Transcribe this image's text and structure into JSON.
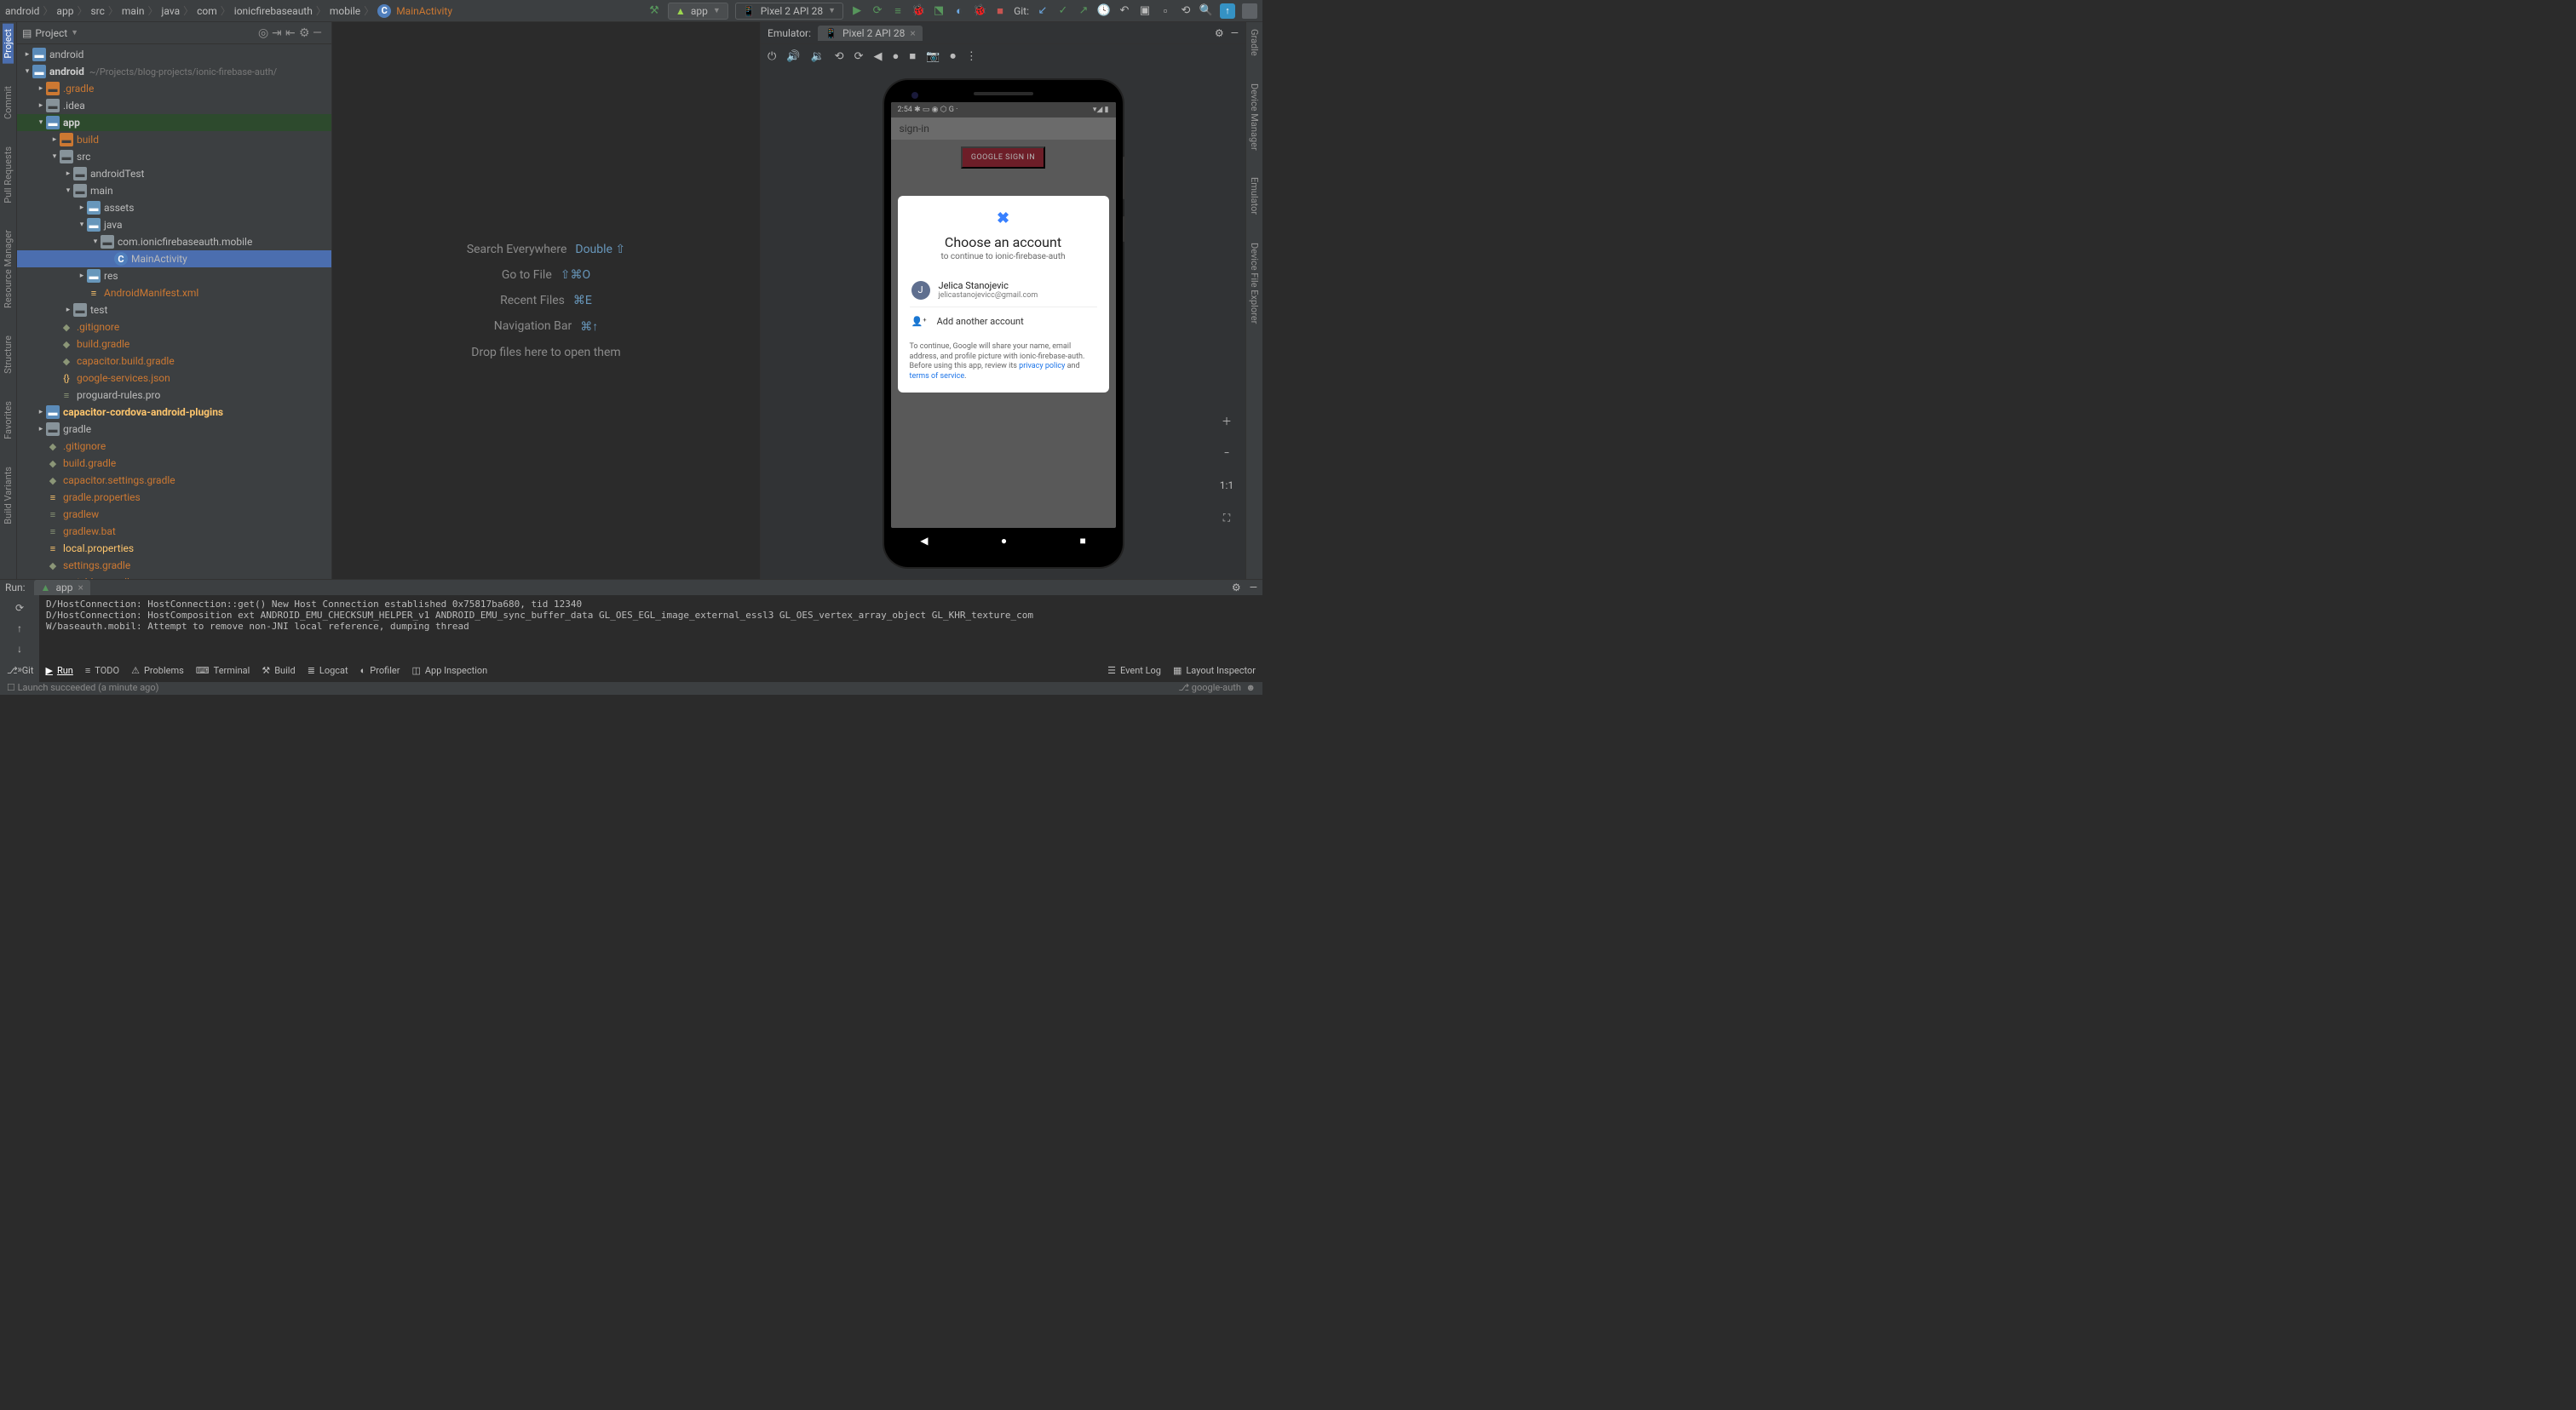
{
  "breadcrumb": [
    "android",
    "app",
    "src",
    "main",
    "java",
    "com",
    "ionicfirebaseauth",
    "mobile",
    "MainActivity"
  ],
  "runConfig": {
    "label": "app"
  },
  "deviceSel": {
    "label": "Pixel 2 API 28"
  },
  "gitLabel": "Git:",
  "projectPanel": {
    "title": "Project"
  },
  "leftStrip": [
    "Project",
    "Commit",
    "Pull Requests",
    "Resource Manager",
    "Structure",
    "Favorites",
    "Build Variants"
  ],
  "rightStrip": [
    "Gradle",
    "Device Manager",
    "Emulator",
    "Device File Explorer"
  ],
  "tree": [
    {
      "d": 0,
      "tw": "▸",
      "icon": "folder-mod",
      "label": "android",
      "cls": ""
    },
    {
      "d": 0,
      "tw": "▾",
      "icon": "folder-mod",
      "label": "android",
      "cls": "bold",
      "suffix": "~/Projects/blog-projects/ionic-firebase-auth/"
    },
    {
      "d": 1,
      "tw": "▸",
      "icon": "folder-o",
      "label": ".gradle",
      "cls": "or"
    },
    {
      "d": 1,
      "tw": "▸",
      "icon": "folder",
      "label": ".idea",
      "cls": ""
    },
    {
      "d": 1,
      "tw": "▾",
      "icon": "folder-mod",
      "label": "app",
      "cls": "bold",
      "hl": true
    },
    {
      "d": 2,
      "tw": "▸",
      "icon": "folder-o",
      "label": "build",
      "cls": "or"
    },
    {
      "d": 2,
      "tw": "▾",
      "icon": "folder",
      "label": "src",
      "cls": ""
    },
    {
      "d": 3,
      "tw": "▸",
      "icon": "folder",
      "label": "androidTest",
      "cls": ""
    },
    {
      "d": 3,
      "tw": "▾",
      "icon": "folder",
      "label": "main",
      "cls": ""
    },
    {
      "d": 4,
      "tw": "▸",
      "icon": "folder-b",
      "label": "assets",
      "cls": ""
    },
    {
      "d": 4,
      "tw": "▾",
      "icon": "folder-b",
      "label": "java",
      "cls": ""
    },
    {
      "d": 5,
      "tw": "▾",
      "icon": "folder",
      "label": "com.ionicfirebaseauth.mobile",
      "cls": ""
    },
    {
      "d": 6,
      "tw": "",
      "icon": "file-c",
      "label": "MainActivity",
      "cls": "",
      "sel": true,
      "ic": "C"
    },
    {
      "d": 4,
      "tw": "▸",
      "icon": "folder-b",
      "label": "res",
      "cls": ""
    },
    {
      "d": 4,
      "tw": "",
      "icon": "file-j",
      "label": "AndroidManifest.xml",
      "cls": "or",
      "ic": "≡"
    },
    {
      "d": 3,
      "tw": "▸",
      "icon": "folder",
      "label": "test",
      "cls": ""
    },
    {
      "d": 2,
      "tw": "",
      "icon": "file-g",
      "label": ".gitignore",
      "cls": "or",
      "ic": "◆"
    },
    {
      "d": 2,
      "tw": "",
      "icon": "file-g",
      "label": "build.gradle",
      "cls": "or",
      "ic": "◆"
    },
    {
      "d": 2,
      "tw": "",
      "icon": "file-g",
      "label": "capacitor.build.gradle",
      "cls": "or",
      "ic": "◆"
    },
    {
      "d": 2,
      "tw": "",
      "icon": "file-j",
      "label": "google-services.json",
      "cls": "or",
      "ic": "{}"
    },
    {
      "d": 2,
      "tw": "",
      "icon": "file-g",
      "label": "proguard-rules.pro",
      "cls": "",
      "ic": "≡"
    },
    {
      "d": 1,
      "tw": "▸",
      "icon": "folder-mod",
      "label": "capacitor-cordova-android-plugins",
      "cls": "gr bold"
    },
    {
      "d": 1,
      "tw": "▸",
      "icon": "folder",
      "label": "gradle",
      "cls": ""
    },
    {
      "d": 1,
      "tw": "",
      "icon": "file-g",
      "label": ".gitignore",
      "cls": "or",
      "ic": "◆"
    },
    {
      "d": 1,
      "tw": "",
      "icon": "file-g",
      "label": "build.gradle",
      "cls": "or",
      "ic": "◆"
    },
    {
      "d": 1,
      "tw": "",
      "icon": "file-g",
      "label": "capacitor.settings.gradle",
      "cls": "or",
      "ic": "◆"
    },
    {
      "d": 1,
      "tw": "",
      "icon": "file-j",
      "label": "gradle.properties",
      "cls": "or",
      "ic": "≡"
    },
    {
      "d": 1,
      "tw": "",
      "icon": "file-g",
      "label": "gradlew",
      "cls": "or",
      "ic": "≡"
    },
    {
      "d": 1,
      "tw": "",
      "icon": "file-g",
      "label": "gradlew.bat",
      "cls": "or",
      "ic": "≡"
    },
    {
      "d": 1,
      "tw": "",
      "icon": "file-j",
      "label": "local.properties",
      "cls": "gr",
      "ic": "≡"
    },
    {
      "d": 1,
      "tw": "",
      "icon": "file-g",
      "label": "settings.gradle",
      "cls": "or",
      "ic": "◆"
    },
    {
      "d": 1,
      "tw": "",
      "icon": "file-g",
      "label": "variables.gradle",
      "cls": "or",
      "ic": "◆"
    }
  ],
  "hints": [
    {
      "label": "Search Everywhere",
      "key": "Double ⇧"
    },
    {
      "label": "Go to File",
      "key": "⇧⌘O"
    },
    {
      "label": "Recent Files",
      "key": "⌘E"
    },
    {
      "label": "Navigation Bar",
      "key": "⌘↑"
    },
    {
      "label": "Drop files here to open them",
      "key": ""
    }
  ],
  "emulator": {
    "headerLabel": "Emulator:",
    "tab": "Pixel 2 API 28",
    "status": {
      "time": "2:54",
      "iconsLeft": "✱ ▭ ◉ ⬡ G ·",
      "iconsRight": "▾◢ ▮"
    },
    "appHeader": "sign-in",
    "gsBtn": "GOOGLE SIGN IN",
    "sheet": {
      "title": "Choose an account",
      "sub": "to continue to ionic-firebase-auth",
      "acct": {
        "initial": "J",
        "name": "Jelica Stanojevic",
        "email": "jelicastanojevicc@gmail.com"
      },
      "add": "Add another account",
      "consentPre": "To continue, Google will share your name, email address, and profile picture with ionic-firebase-auth. Before using this app, review its ",
      "pp": "privacy policy",
      "and": " and ",
      "tos": "terms of service",
      "dot": "."
    },
    "sideBtns": [
      "＋",
      "−",
      "1:1",
      "⛶"
    ]
  },
  "run": {
    "label": "Run:",
    "tab": "app",
    "lines": [
      "D/HostConnection: HostConnection::get() New Host Connection established 0x75817ba680, tid 12340",
      "D/HostConnection: HostComposition ext ANDROID_EMU_CHECKSUM_HELPER_v1 ANDROID_EMU_sync_buffer_data GL_OES_EGL_image_external_essl3 GL_OES_vertex_array_object GL_KHR_texture_com",
      "W/baseauth.mobil: Attempt to remove non-JNI local reference, dumping thread"
    ]
  },
  "bottomTabs": [
    "Git",
    "Run",
    "TODO",
    "Problems",
    "Terminal",
    "Build",
    "Logcat",
    "Profiler",
    "App Inspection"
  ],
  "bottomRight": [
    "Event Log",
    "Layout Inspector"
  ],
  "status": {
    "left": "Launch succeeded (a minute ago)",
    "branch": "google-auth"
  }
}
